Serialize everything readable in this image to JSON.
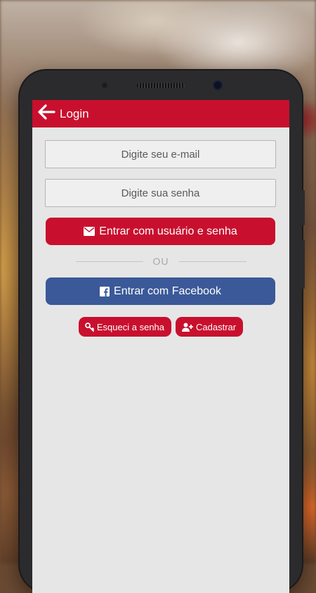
{
  "appbar": {
    "title": "Login",
    "back_icon": "arrow-left-icon",
    "color": "#c8102e"
  },
  "form": {
    "email_placeholder": "Digite seu e-mail",
    "password_placeholder": "Digite sua senha",
    "email_value": "",
    "password_value": ""
  },
  "buttons": {
    "login_label": "Entrar com usuário e senha",
    "login_icon": "envelope-icon",
    "divider_text": "OU",
    "facebook_label": "Entrar com Facebook",
    "facebook_icon": "facebook-icon",
    "facebook_color": "#3b5998",
    "forgot_label": "Esqueci a senha",
    "forgot_icon": "key-icon",
    "register_label": "Cadastrar",
    "register_icon": "user-plus-icon"
  }
}
